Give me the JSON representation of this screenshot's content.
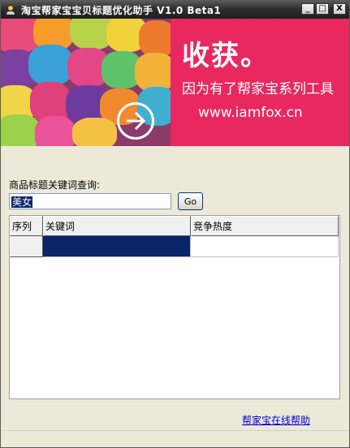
{
  "window": {
    "title": "淘宝帮家宝宝贝标题优化助手 V1.0 Beta1",
    "controls": {
      "minimize": "_",
      "maximize": "□",
      "close": "X"
    }
  },
  "banner": {
    "headline": "收获。",
    "subline": "因为有了帮家宝系列工具",
    "url": "www.iamfox.cn",
    "accent_color": "#e8285f"
  },
  "search": {
    "label": "商品标题关键词查询:",
    "value": "美女",
    "go_label": "Go"
  },
  "table": {
    "columns": [
      "序列",
      "关键词",
      "竞争热度"
    ],
    "rows": [
      {
        "index": "",
        "keyword": "",
        "heat": ""
      }
    ]
  },
  "footer": {
    "help_link": "帮家宝在线帮助"
  }
}
